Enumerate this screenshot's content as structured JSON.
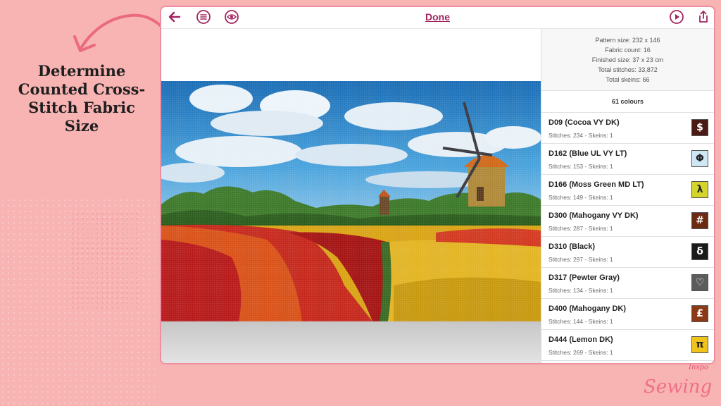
{
  "slide": {
    "heading": "Determine Counted Cross-Stitch Fabric Size",
    "brand_script": "Sewing",
    "brand_small": "Inspo"
  },
  "toolbar": {
    "title": "Done",
    "back_icon": "arrow-left-icon",
    "menu_icon": "list-circle-icon",
    "eye_icon": "eye-circle-icon",
    "play_icon": "play-circle-icon",
    "share_icon": "share-icon",
    "accent": "#a3245f"
  },
  "info": {
    "pattern_size": "Pattern size: 232 x 146",
    "fabric_count": "Fabric count: 16",
    "finished_size": "Finished size: 37 x 23 cm",
    "total_stitches": "Total stitches: 33,872",
    "total_skeins": "Total skeins: 66"
  },
  "colours_header": "61 colours",
  "threads": [
    {
      "name": "D09 (Cocoa VY DK)",
      "meta": "Stitches: 234 - Skeins: 1",
      "symbol": "$",
      "color": "#4a1a14",
      "fg": "#ffffff"
    },
    {
      "name": "D162 (Blue UL VY LT)",
      "meta": "Stitches: 153 - Skeins: 1",
      "symbol": "Φ",
      "color": "#cfe6f4",
      "fg": "#222222"
    },
    {
      "name": "D166 (Moss Green MD LT)",
      "meta": "Stitches: 149 - Skeins: 1",
      "symbol": "λ",
      "color": "#d4d42a",
      "fg": "#222222"
    },
    {
      "name": "D300 (Mahogany VY DK)",
      "meta": "Stitches: 287 - Skeins: 1",
      "symbol": "#",
      "color": "#6b2a12",
      "fg": "#ffffff"
    },
    {
      "name": "D310 (Black)",
      "meta": "Stitches: 297 - Skeins: 1",
      "symbol": "δ",
      "color": "#1a1a1a",
      "fg": "#ffffff"
    },
    {
      "name": "D317 (Pewter Gray)",
      "meta": "Stitches: 134 - Skeins: 1",
      "symbol": "♡",
      "color": "#5c5c5c",
      "fg": "#ffffff"
    },
    {
      "name": "D400 (Mahogany DK)",
      "meta": "Stitches: 144 - Skeins: 1",
      "symbol": "£",
      "color": "#8a3a16",
      "fg": "#ffffff"
    },
    {
      "name": "D444 (Lemon DK)",
      "meta": "Stitches: 269 - Skeins: 1",
      "symbol": "π",
      "color": "#f0c21c",
      "fg": "#222222"
    }
  ]
}
